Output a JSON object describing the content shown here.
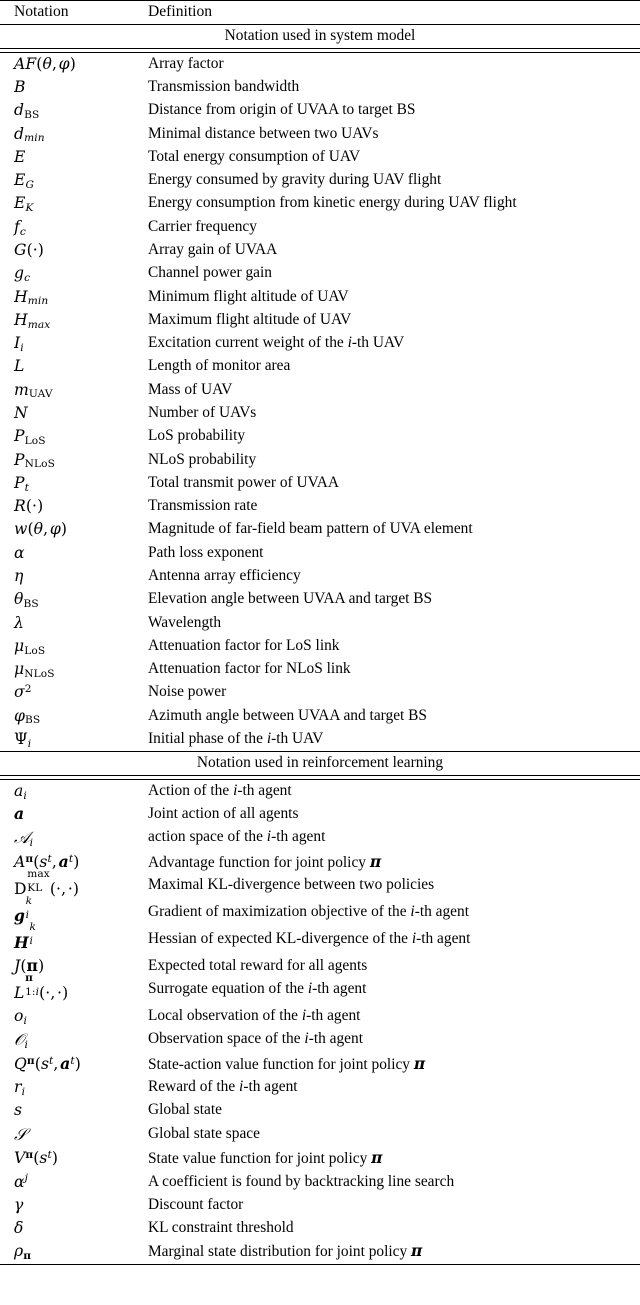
{
  "table": {
    "columns": [
      "Notation",
      "Definition"
    ],
    "sections": [
      {
        "title": "Notation used in system model",
        "rows": [
          {
            "notation_plain": "AF(θ, φ)",
            "definition": "Array factor"
          },
          {
            "notation_plain": "B",
            "definition": "Transmission bandwidth"
          },
          {
            "notation_plain": "d_BS",
            "definition": "Distance from origin of UVAA to target BS"
          },
          {
            "notation_plain": "d_min",
            "definition": "Minimal distance between two UAVs"
          },
          {
            "notation_plain": "E",
            "definition": "Total energy consumption of UAV"
          },
          {
            "notation_plain": "E_G",
            "definition": "Energy consumed by gravity during UAV flight"
          },
          {
            "notation_plain": "E_K",
            "definition": "Energy consumption from kinetic energy during UAV flight"
          },
          {
            "notation_plain": "f_c",
            "definition": "Carrier frequency"
          },
          {
            "notation_plain": "G(·)",
            "definition": "Array gain of UVAA"
          },
          {
            "notation_plain": "g_c",
            "definition": "Channel power gain"
          },
          {
            "notation_plain": "H_min",
            "definition": "Minimum flight altitude of UAV"
          },
          {
            "notation_plain": "H_max",
            "definition": "Maximum flight altitude of UAV"
          },
          {
            "notation_plain": "I_i",
            "definition": "Excitation current weight of the i-th UAV"
          },
          {
            "notation_plain": "L",
            "definition": "Length of monitor area"
          },
          {
            "notation_plain": "m_UAV",
            "definition": "Mass of UAV"
          },
          {
            "notation_plain": "N",
            "definition": "Number of UAVs"
          },
          {
            "notation_plain": "P_LoS",
            "definition": "LoS probability"
          },
          {
            "notation_plain": "P_NLoS",
            "definition": "NLoS probability"
          },
          {
            "notation_plain": "P_t",
            "definition": "Total transmit power of UVAA"
          },
          {
            "notation_plain": "R(·)",
            "definition": "Transmission rate"
          },
          {
            "notation_plain": "w(θ, φ)",
            "definition": "Magnitude of far-field beam pattern of UVA element"
          },
          {
            "notation_plain": "α",
            "definition": "Path loss exponent"
          },
          {
            "notation_plain": "η",
            "definition": "Antenna array efficiency"
          },
          {
            "notation_plain": "θ_BS",
            "definition": "Elevation angle between UVAA and target BS"
          },
          {
            "notation_plain": "λ",
            "definition": "Wavelength"
          },
          {
            "notation_plain": "μ_LoS",
            "definition": "Attenuation factor for LoS link"
          },
          {
            "notation_plain": "μ_NLoS",
            "definition": "Attenuation factor for NLoS link"
          },
          {
            "notation_plain": "σ²",
            "definition": "Noise power"
          },
          {
            "notation_plain": "φ_BS",
            "definition": "Azimuth angle between UVAA and target BS"
          },
          {
            "notation_plain": "Ψ_i",
            "definition": "Initial phase of the i-th UAV"
          }
        ]
      },
      {
        "title": "Notation used in reinforcement learning",
        "rows": [
          {
            "notation_plain": "a_i",
            "definition": "Action of the i-th agent"
          },
          {
            "notation_plain": "a",
            "definition": "Joint action of all agents"
          },
          {
            "notation_plain": "𝒜_i",
            "definition": "action space of the i-th agent"
          },
          {
            "notation_plain": "A^π(s^t, a^t)",
            "definition": "Advantage function for joint policy π"
          },
          {
            "notation_plain": "D_KL^max(·, ·)",
            "definition": "Maximal KL-divergence between two policies"
          },
          {
            "notation_plain": "g_i^k",
            "definition": "Gradient of maximization objective of the i-th agent"
          },
          {
            "notation_plain": "H_i^k",
            "definition": "Hessian of expected KL-divergence of the i-th agent"
          },
          {
            "notation_plain": "J(π)",
            "definition": "Expected total reward for all agents"
          },
          {
            "notation_plain": "L_{1:i}^π(·, ·)",
            "definition": "Surrogate equation of the i-th agent"
          },
          {
            "notation_plain": "o_i",
            "definition": "Local observation of the i-th agent"
          },
          {
            "notation_plain": "𝒪_i",
            "definition": "Observation space of the i-th agent"
          },
          {
            "notation_plain": "Q^π(s^t, a^t)",
            "definition": "State-action value function for joint policy π"
          },
          {
            "notation_plain": "r_i",
            "definition": "Reward of the i-th agent"
          },
          {
            "notation_plain": "s",
            "definition": "Global state"
          },
          {
            "notation_plain": "𝒮",
            "definition": "Global state space"
          },
          {
            "notation_plain": "V^π(s^t)",
            "definition": "State value function for joint policy π"
          },
          {
            "notation_plain": "α^j",
            "definition": "A coefficient is found by backtracking line search"
          },
          {
            "notation_plain": "γ",
            "definition": "Discount factor"
          },
          {
            "notation_plain": "δ",
            "definition": "KL constraint threshold"
          },
          {
            "notation_plain": "ρ_π",
            "definition": "Marginal state distribution for joint policy π"
          }
        ]
      }
    ]
  }
}
